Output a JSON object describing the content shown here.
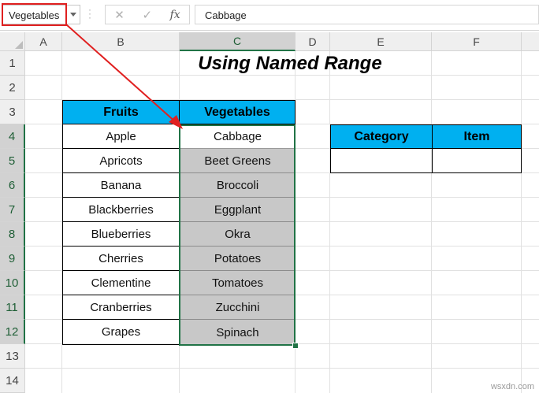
{
  "formula_bar": {
    "name_box": "Vegetables",
    "cancel_glyph": "✕",
    "enter_glyph": "✓",
    "fx_label": "fx",
    "formula_value": "Cabbage"
  },
  "columns": [
    "A",
    "B",
    "C",
    "D",
    "E",
    "F"
  ],
  "rows": [
    "1",
    "2",
    "3",
    "4",
    "5",
    "6",
    "7",
    "8",
    "9",
    "10",
    "11",
    "12",
    "13",
    "14"
  ],
  "title": "Using Named Range",
  "table": {
    "headers": [
      "Fruits",
      "Vegetables"
    ],
    "fruits": [
      "Apple",
      "Apricots",
      "Banana",
      "Blackberries",
      "Blueberries",
      "Cherries",
      "Clementine",
      "Cranberries",
      "Grapes"
    ],
    "vegetables": [
      "Cabbage",
      "Beet Greens",
      "Broccoli",
      "Eggplant",
      "Okra",
      "Potatoes",
      "Tomatoes",
      "Zucchini",
      "Spinach"
    ]
  },
  "lookup": {
    "headers": [
      "Category",
      "Item"
    ],
    "values": [
      "",
      ""
    ]
  },
  "watermark": "wsxdn.com",
  "colors": {
    "header_fill": "#00b0f0",
    "selection_fill": "#c8c8c8",
    "selection_border": "#217346",
    "annotation": "#e02020"
  }
}
